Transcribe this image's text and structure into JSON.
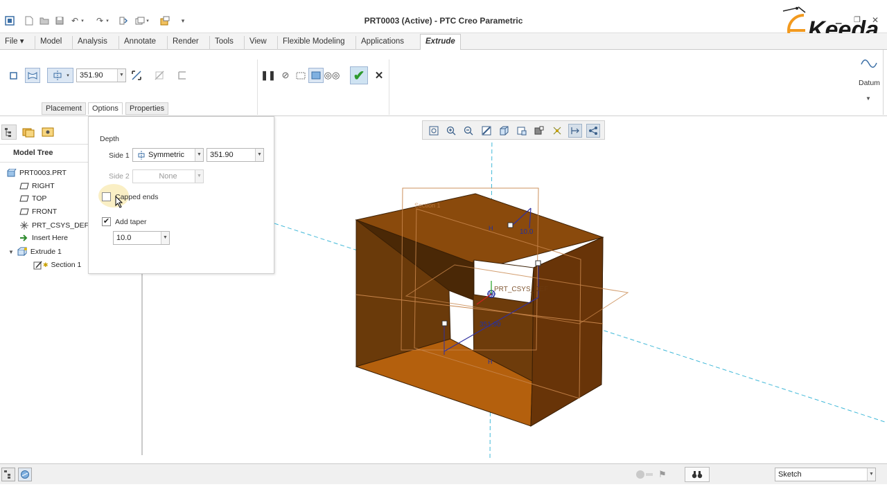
{
  "window": {
    "title": "PRT0003 (Active) - PTC Creo Parametric"
  },
  "quick_access": [
    "new-icon",
    "open-icon",
    "save-icon",
    "undo-icon",
    "redo-icon",
    "regenerate-icon",
    "windows-icon",
    "close-window-icon",
    "customize-icon"
  ],
  "menu": {
    "file": "File ▾",
    "tabs": [
      "Model",
      "Analysis",
      "Annotate",
      "Render",
      "Tools",
      "View",
      "Flexible Modeling",
      "Applications"
    ],
    "active_tab": "Extrude"
  },
  "ribbon": {
    "depth_value": "351.90",
    "subtabs": [
      "Placement",
      "Options",
      "Properties"
    ],
    "datum_label": "Datum"
  },
  "model_tree": {
    "title": "Model Tree",
    "items": [
      {
        "label": "PRT0003.PRT"
      },
      {
        "label": "RIGHT"
      },
      {
        "label": "TOP"
      },
      {
        "label": "FRONT"
      },
      {
        "label": "PRT_CSYS_DEF"
      },
      {
        "label": "Insert Here"
      },
      {
        "label": "Extrude 1"
      },
      {
        "label": "Section 1"
      }
    ]
  },
  "options": {
    "depth_header": "Depth",
    "side1_label": "Side 1",
    "side1_type": "Symmetric",
    "side1_value": "351.90",
    "side2_label": "Side 2",
    "side2_type": "None",
    "capped_ends_label": "Capped ends",
    "capped_ends_checked": false,
    "add_taper_label": "Add taper",
    "add_taper_checked": true,
    "taper_value": "10.0"
  },
  "viewport": {
    "dim_depth": "351.90",
    "dim_taper": "10.0",
    "csys_label": "PRT_CSYS_DEF",
    "section_label": "Section 1",
    "h_marker": "H",
    "part_color": "#8a4a0c"
  },
  "statusbar": {
    "filter_value": "Sketch"
  },
  "logo": {
    "text": "Keeda"
  }
}
